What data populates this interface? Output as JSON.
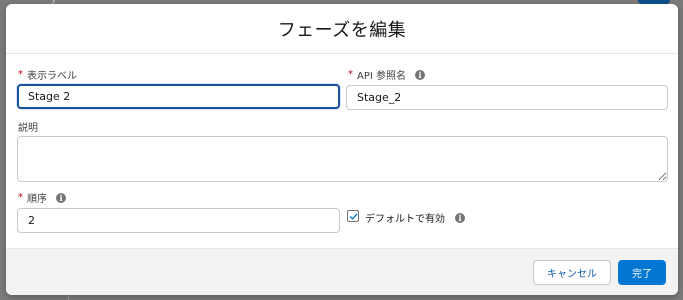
{
  "modal": {
    "title": "フェーズを編集"
  },
  "fields": {
    "display_label": {
      "required_mark": "*",
      "label": "表示ラベル",
      "value": "Stage 2"
    },
    "api_name": {
      "required_mark": "*",
      "label": "API 参照名",
      "value": "Stage_2",
      "info_icon": "info-icon"
    },
    "description": {
      "label": "説明",
      "value": ""
    },
    "order": {
      "required_mark": "*",
      "label": "順序",
      "value": "2",
      "info_icon": "info-icon"
    },
    "default_checkbox": {
      "label": "デフォルトで有効",
      "checked": true,
      "info_icon": "info-icon"
    }
  },
  "footer": {
    "cancel_label": "キャンセル",
    "done_label": "完了"
  },
  "colors": {
    "accent": "#0176d3",
    "focus_border": "#1b5297",
    "required": "#ba0517",
    "link": "#0b5cab"
  }
}
